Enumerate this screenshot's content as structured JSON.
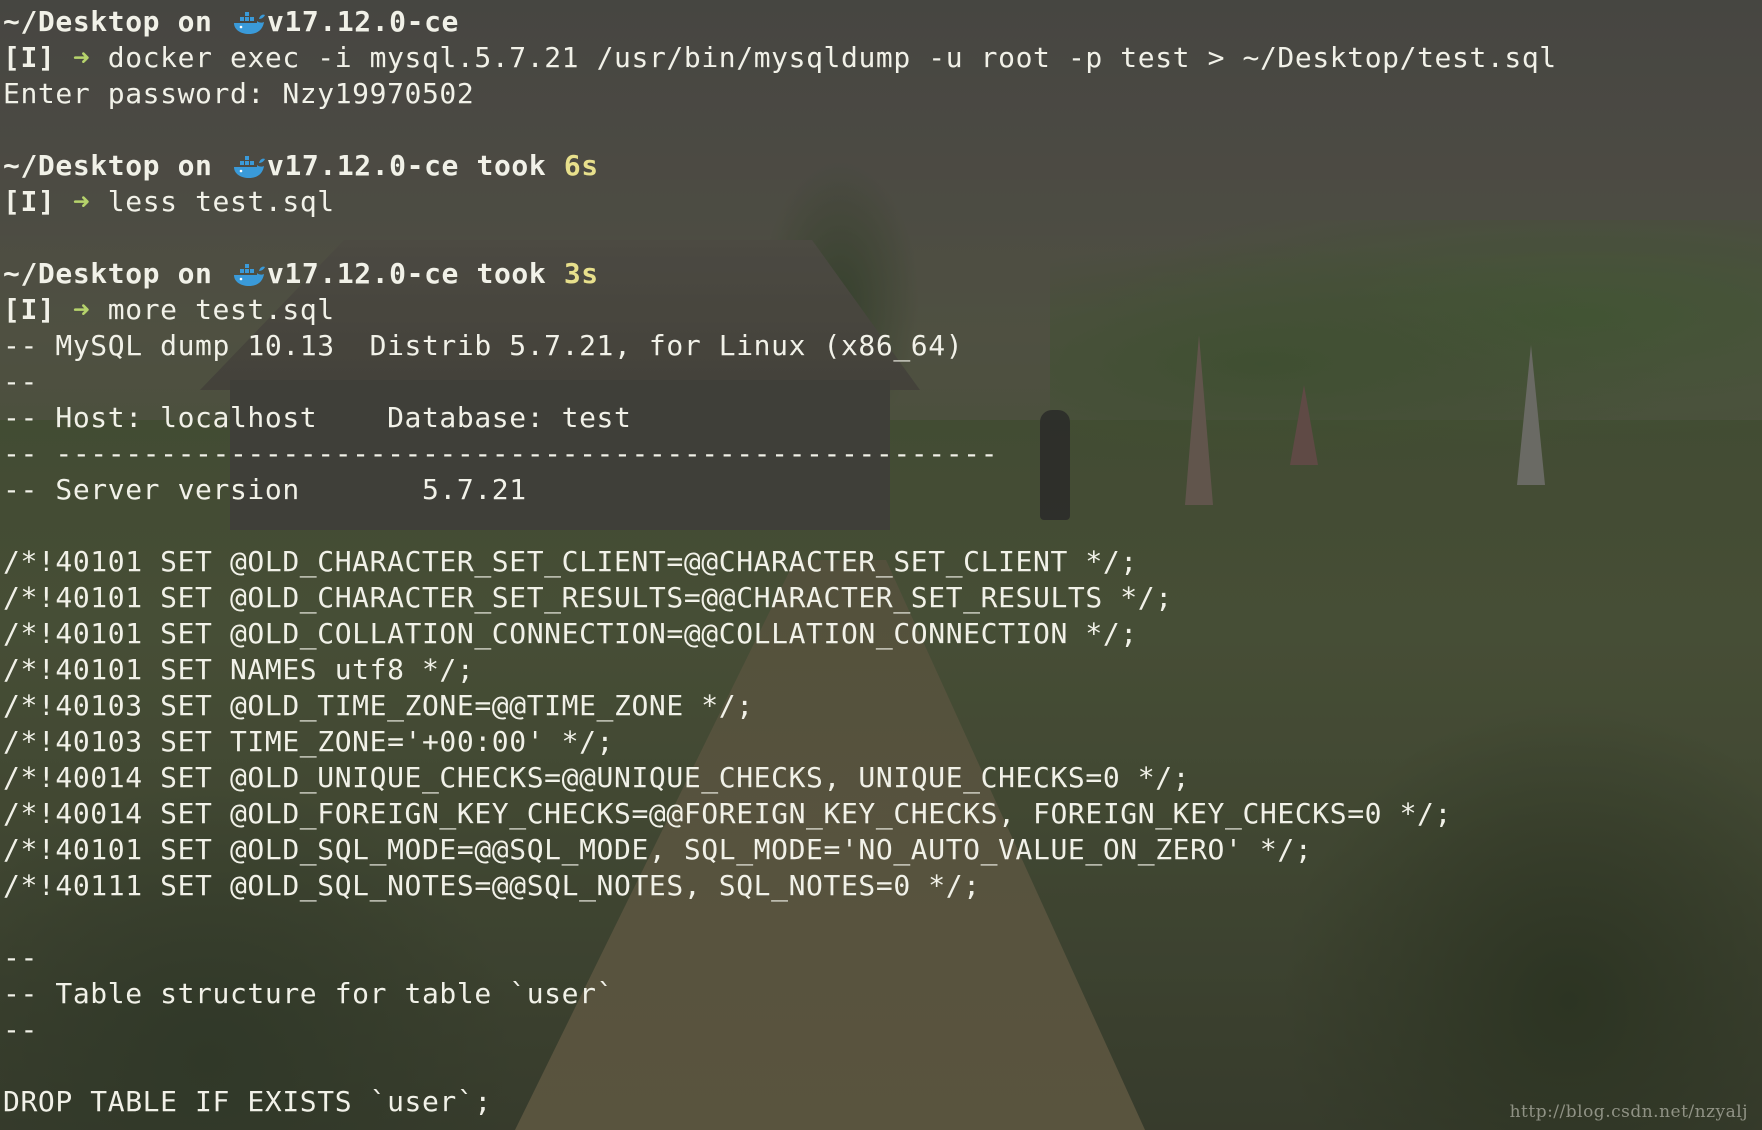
{
  "terminal": {
    "prompts": [
      {
        "path": "~/Desktop",
        "on_word": "on",
        "docker_version": "v17.12.0-ce",
        "took_word": "",
        "duration": "",
        "mode": "[I]",
        "command": "docker exec -i mysql.5.7.21 /usr/bin/mysqldump -u root -p test > ~/Desktop/test.sql"
      },
      {
        "path": "~/Desktop",
        "on_word": "on",
        "docker_version": "v17.12.0-ce",
        "took_word": "took",
        "duration": "6s",
        "mode": "[I]",
        "command": "less test.sql"
      },
      {
        "path": "~/Desktop",
        "on_word": "on",
        "docker_version": "v17.12.0-ce",
        "took_word": "took",
        "duration": "3s",
        "mode": "[I]",
        "command": "more test.sql"
      }
    ],
    "password_line": "Enter password: Nzy19970502",
    "dump_output": [
      "-- MySQL dump 10.13  Distrib 5.7.21, for Linux (x86_64)",
      "--",
      "-- Host: localhost    Database: test",
      "-- ------------------------------------------------------",
      "-- Server version       5.7.21",
      "",
      "/*!40101 SET @OLD_CHARACTER_SET_CLIENT=@@CHARACTER_SET_CLIENT */;",
      "/*!40101 SET @OLD_CHARACTER_SET_RESULTS=@@CHARACTER_SET_RESULTS */;",
      "/*!40101 SET @OLD_COLLATION_CONNECTION=@@COLLATION_CONNECTION */;",
      "/*!40101 SET NAMES utf8 */;",
      "/*!40103 SET @OLD_TIME_ZONE=@@TIME_ZONE */;",
      "/*!40103 SET TIME_ZONE='+00:00' */;",
      "/*!40014 SET @OLD_UNIQUE_CHECKS=@@UNIQUE_CHECKS, UNIQUE_CHECKS=0 */;",
      "/*!40014 SET @OLD_FOREIGN_KEY_CHECKS=@@FOREIGN_KEY_CHECKS, FOREIGN_KEY_CHECKS=0 */;",
      "/*!40101 SET @OLD_SQL_MODE=@@SQL_MODE, SQL_MODE='NO_AUTO_VALUE_ON_ZERO' */;",
      "/*!40111 SET @OLD_SQL_NOTES=@@SQL_NOTES, SQL_NOTES=0 */;",
      "",
      "--",
      "-- Table structure for table `user`",
      "--",
      "",
      "DROP TABLE IF EXISTS `user`;"
    ],
    "icons": {
      "docker": "whale-icon",
      "prompt_arrow": "arrow-right-icon"
    },
    "colors": {
      "text": "#f1f1e8",
      "duration": "#e8e08c",
      "arrow": "#b6d36c",
      "whale": "#3a9ad9"
    }
  },
  "watermark": "http://blog.csdn.net/nzyalj"
}
